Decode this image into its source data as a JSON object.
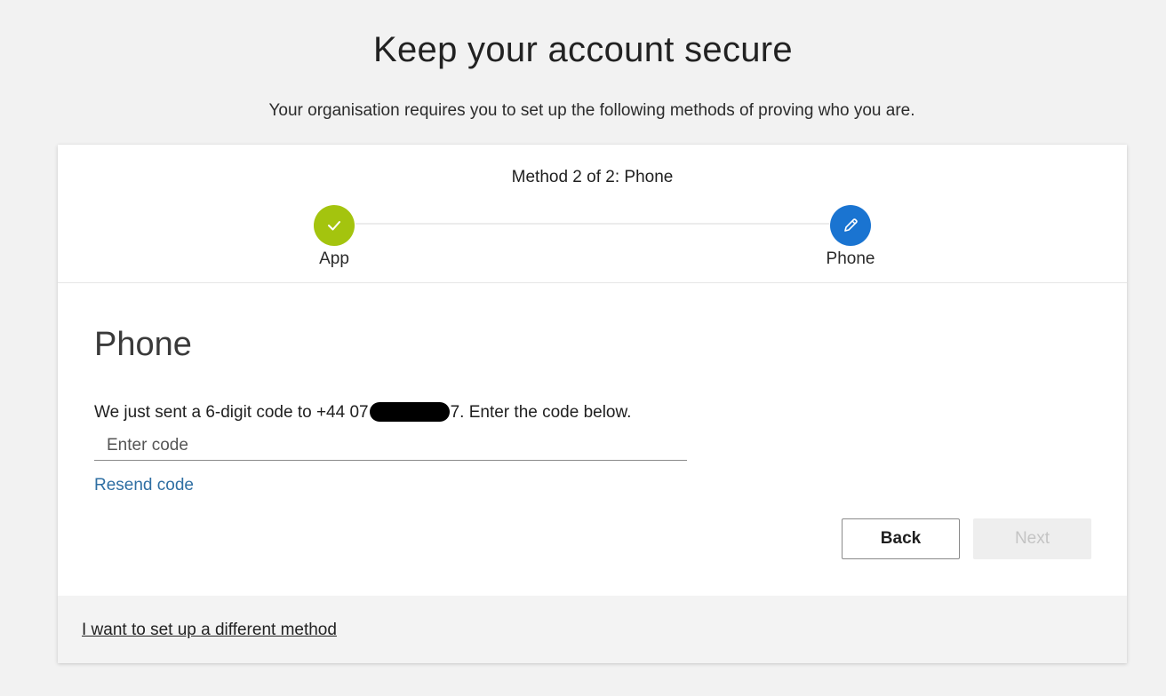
{
  "header": {
    "title": "Keep your account secure",
    "subtitle": "Your organisation requires you to set up the following methods of proving who you are."
  },
  "progress": {
    "method_label": "Method 2 of 2: Phone",
    "steps": [
      {
        "label": "App",
        "status": "complete",
        "icon": "checkmark-icon",
        "color": "#a4c40e"
      },
      {
        "label": "Phone",
        "status": "current",
        "icon": "pencil-icon",
        "color": "#1a74d1"
      }
    ]
  },
  "phone_section": {
    "title": "Phone",
    "instruction_prefix": "We just sent a 6-digit code to +44 07",
    "instruction_suffix": "7. Enter the code below.",
    "code_input": {
      "placeholder": "Enter code",
      "value": ""
    },
    "resend_label": "Resend code"
  },
  "buttons": {
    "back_label": "Back",
    "next_label": "Next",
    "next_enabled": false
  },
  "footer": {
    "alternate_method_label": "I want to set up a different method"
  },
  "colors": {
    "link": "#2f6fa3",
    "complete": "#a4c40e",
    "active": "#1a74d1"
  }
}
